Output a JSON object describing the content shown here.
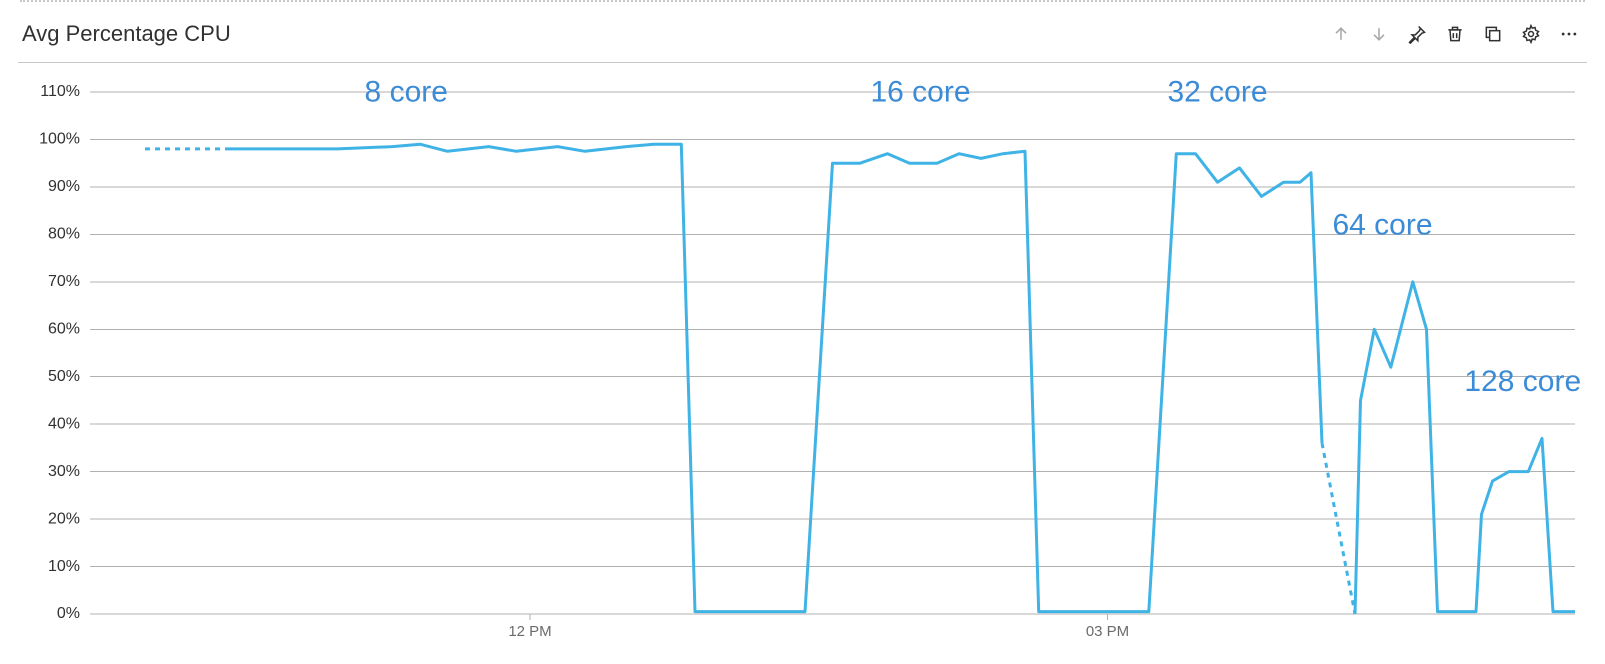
{
  "header": {
    "title": "Avg Percentage CPU"
  },
  "chart_data": {
    "type": "line",
    "title": "Avg Percentage CPU",
    "xlabel": "",
    "ylabel": "",
    "ylim": [
      0,
      110
    ],
    "y_ticks": [
      0,
      10,
      20,
      30,
      40,
      50,
      60,
      70,
      80,
      90,
      100,
      110
    ],
    "y_tick_labels": [
      "0%",
      "10%",
      "20%",
      "30%",
      "40%",
      "50%",
      "60%",
      "70%",
      "80%",
      "90%",
      "100%",
      "110%"
    ],
    "xlim": [
      0,
      540
    ],
    "x_ticks": [
      160,
      370
    ],
    "x_tick_labels": [
      "12 PM",
      "03 PM"
    ],
    "annotations": [
      {
        "label": "8 core",
        "x": 115,
        "y": 108
      },
      {
        "label": "16 core",
        "x": 302,
        "y": 108
      },
      {
        "label": "32 core",
        "x": 410,
        "y": 108
      },
      {
        "label": "64 core",
        "x": 470,
        "y": 80
      },
      {
        "label": "128 core",
        "x": 521,
        "y": 47
      }
    ],
    "segments": [
      {
        "dashed": true,
        "points": [
          {
            "x": 20,
            "y": 98
          },
          {
            "x": 50,
            "y": 98
          }
        ]
      },
      {
        "dashed": false,
        "points": [
          {
            "x": 50,
            "y": 98
          },
          {
            "x": 70,
            "y": 98
          },
          {
            "x": 90,
            "y": 98
          },
          {
            "x": 110,
            "y": 98.5
          },
          {
            "x": 120,
            "y": 99
          },
          {
            "x": 130,
            "y": 97.5
          },
          {
            "x": 145,
            "y": 98.5
          },
          {
            "x": 155,
            "y": 97.5
          },
          {
            "x": 170,
            "y": 98.5
          },
          {
            "x": 180,
            "y": 97.5
          },
          {
            "x": 195,
            "y": 98.5
          },
          {
            "x": 205,
            "y": 99
          },
          {
            "x": 215,
            "y": 99
          },
          {
            "x": 220,
            "y": 0.5
          },
          {
            "x": 260,
            "y": 0.5
          },
          {
            "x": 270,
            "y": 95
          },
          {
            "x": 280,
            "y": 95
          },
          {
            "x": 290,
            "y": 97
          },
          {
            "x": 298,
            "y": 95
          },
          {
            "x": 308,
            "y": 95
          },
          {
            "x": 316,
            "y": 97
          },
          {
            "x": 324,
            "y": 96
          },
          {
            "x": 332,
            "y": 97
          },
          {
            "x": 340,
            "y": 97.5
          },
          {
            "x": 345,
            "y": 0.5
          },
          {
            "x": 385,
            "y": 0.5
          },
          {
            "x": 395,
            "y": 97
          },
          {
            "x": 402,
            "y": 97
          },
          {
            "x": 410,
            "y": 91
          },
          {
            "x": 418,
            "y": 94
          },
          {
            "x": 426,
            "y": 88
          },
          {
            "x": 434,
            "y": 91
          },
          {
            "x": 440,
            "y": 91
          },
          {
            "x": 444,
            "y": 93
          },
          {
            "x": 448,
            "y": 36
          }
        ]
      },
      {
        "dashed": true,
        "points": [
          {
            "x": 448,
            "y": 36
          },
          {
            "x": 460,
            "y": 0
          }
        ]
      },
      {
        "dashed": false,
        "points": [
          {
            "x": 460,
            "y": 0
          },
          {
            "x": 462,
            "y": 45
          },
          {
            "x": 467,
            "y": 60
          },
          {
            "x": 473,
            "y": 52
          },
          {
            "x": 481,
            "y": 70
          },
          {
            "x": 486,
            "y": 60
          },
          {
            "x": 490,
            "y": 0.5
          },
          {
            "x": 504,
            "y": 0.5
          },
          {
            "x": 506,
            "y": 21
          },
          {
            "x": 510,
            "y": 28
          },
          {
            "x": 516,
            "y": 30
          },
          {
            "x": 523,
            "y": 30
          },
          {
            "x": 528,
            "y": 37
          },
          {
            "x": 532,
            "y": 0.5
          },
          {
            "x": 540,
            "y": 0.5
          }
        ]
      }
    ]
  }
}
